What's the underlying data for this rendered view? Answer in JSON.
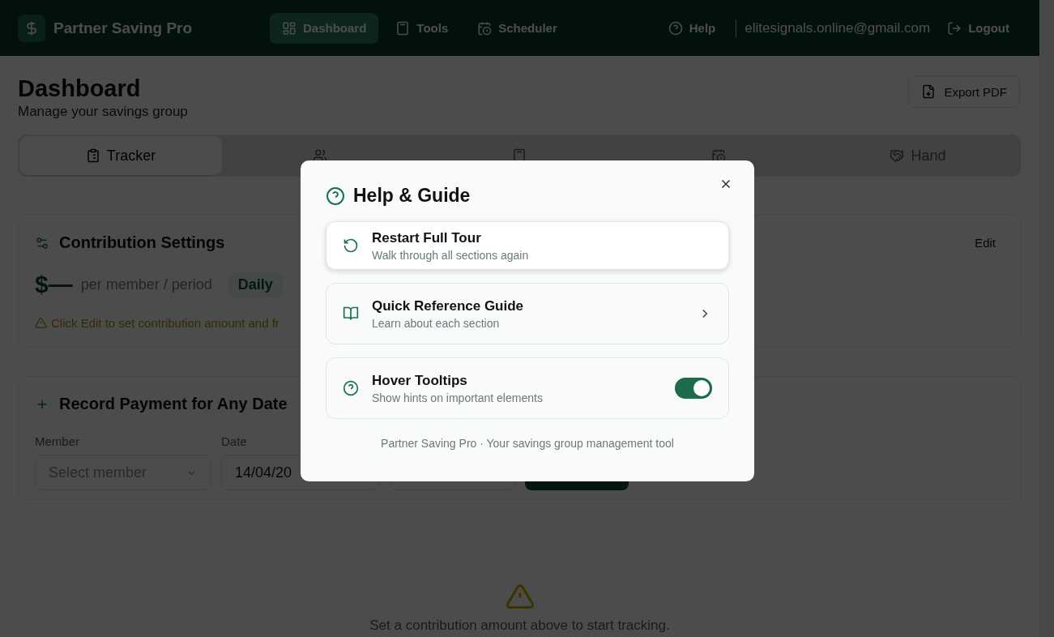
{
  "nav": {
    "brand": "Partner Saving Pro",
    "links": [
      {
        "label": "Dashboard",
        "selected": true
      },
      {
        "label": "Tools",
        "selected": false
      },
      {
        "label": "Scheduler",
        "selected": false
      }
    ],
    "help": "Help",
    "email": "elitesignals.online@gmail.com",
    "logout": "Logout"
  },
  "header": {
    "title": "Dashboard",
    "subtitle": "Manage your savings group",
    "export": "Export PDF"
  },
  "tabs": [
    {
      "label": "Tracker",
      "selected": true
    },
    {
      "selected": false
    },
    {
      "selected": false
    },
    {
      "selected": false
    },
    {
      "label": "Hand",
      "selected": false
    }
  ],
  "contribution": {
    "title": "Contribution Settings",
    "edit": "Edit",
    "amount": "$—",
    "per": "per member / period",
    "frequency": "Daily",
    "warning": "Click Edit to set contribution amount and fr"
  },
  "record": {
    "title": "Record Payment for Any Date",
    "member_label": "Member",
    "member_placeholder": "Select member",
    "date_label": "Date",
    "date_value": "14/04/20"
  },
  "empty": {
    "message": "Set a contribution amount above to start tracking."
  },
  "modal": {
    "title": "Help & Guide",
    "items": [
      {
        "kind": "action",
        "title": "Restart Full Tour",
        "desc": "Walk through all sections again",
        "selected": true
      },
      {
        "kind": "link",
        "title": "Quick Reference Guide",
        "desc": "Learn about each section",
        "selected": false
      },
      {
        "kind": "toggle",
        "title": "Hover Tooltips",
        "desc": "Show hints on important elements",
        "on": true,
        "selected": false
      }
    ],
    "footer": "Partner Saving Pro · Your savings group management tool"
  }
}
